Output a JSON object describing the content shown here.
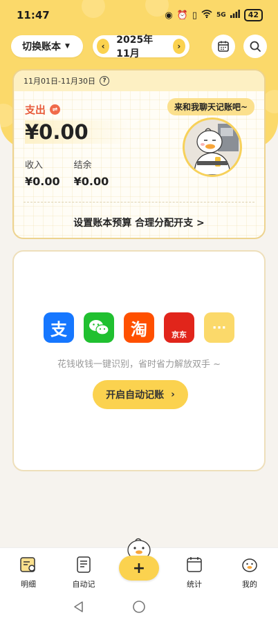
{
  "status_bar": {
    "time": "11:47",
    "network": "5G",
    "battery": "42"
  },
  "toolbar": {
    "switch_book_label": "切换账本",
    "month": "2025年11月"
  },
  "summary": {
    "date_range": "11月01日-11月30日",
    "help": "?",
    "expense_label": "支出",
    "swap_symbol": "⇌",
    "expense_amount": "¥0.00",
    "income_label": "收入",
    "income_amount": "¥0.00",
    "balance_label": "结余",
    "balance_amount": "¥0.00",
    "chat_prompt": "来和我聊天记账吧~",
    "budget_link": "设置账本预算 合理分配开支 >"
  },
  "auto_record": {
    "apps": [
      {
        "glyph": "支",
        "color": "#1677ff"
      },
      {
        "glyph": "",
        "color": "#20c030"
      },
      {
        "glyph": "淘",
        "color": "#ff5000"
      },
      {
        "glyph": "京东",
        "color": "#e1251b"
      },
      {
        "glyph": "···",
        "color": "#fbd96a"
      }
    ],
    "hint": "花钱收钱一键识别，省时省力解放双手 ~",
    "button_label": "开启自动记账",
    "button_arrow": "›"
  },
  "bottom_nav": {
    "items": [
      {
        "label": "明细"
      },
      {
        "label": "自动记"
      },
      {
        "label": "+"
      },
      {
        "label": "统计"
      },
      {
        "label": "我的"
      }
    ]
  },
  "colors": {
    "accent": "#fbd24f",
    "expense": "#e85a3b"
  }
}
